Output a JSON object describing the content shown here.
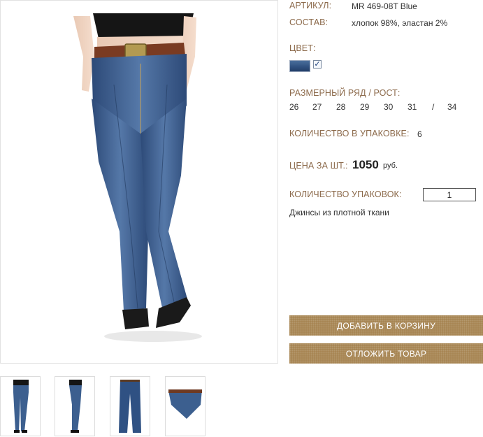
{
  "product": {
    "article_label": "АРТИКУЛ:",
    "article_value": "MR 469-08T Blue",
    "composition_label": "СОСТАВ:",
    "composition_value": "хлопок 98%, эластан 2%",
    "color_label": "ЦВЕТ:",
    "color_swatch": {
      "color": "#3a5d8c",
      "selected": true
    },
    "size_label": "РАЗМЕРНЫЙ РЯД / РОСТ:",
    "sizes": [
      "26",
      "27",
      "28",
      "29",
      "30",
      "31",
      "/",
      "34"
    ],
    "pack_qty_label": "КОЛИЧЕСТВО В УПАКОВКЕ:",
    "pack_qty_value": "6",
    "price_label": "ЦЕНА ЗА ШТ.:",
    "price_value": "1050",
    "price_currency": "руб.",
    "packs_label": "КОЛИЧЕСТВО УПАКОВОК:",
    "packs_value": "1",
    "description": "Джинсы из плотной ткани"
  },
  "buttons": {
    "add_to_cart": "ДОБАВИТЬ В КОРЗИНУ",
    "save_item": "ОТЛОЖИТЬ ТОВАР"
  },
  "colors": {
    "label_brown": "#8c6a4b",
    "button_brown": "#a5824f",
    "denim_blue": "#3a5d8c"
  },
  "thumbnails": [
    "front-view",
    "side-view",
    "flat-view",
    "waist-detail-view"
  ]
}
